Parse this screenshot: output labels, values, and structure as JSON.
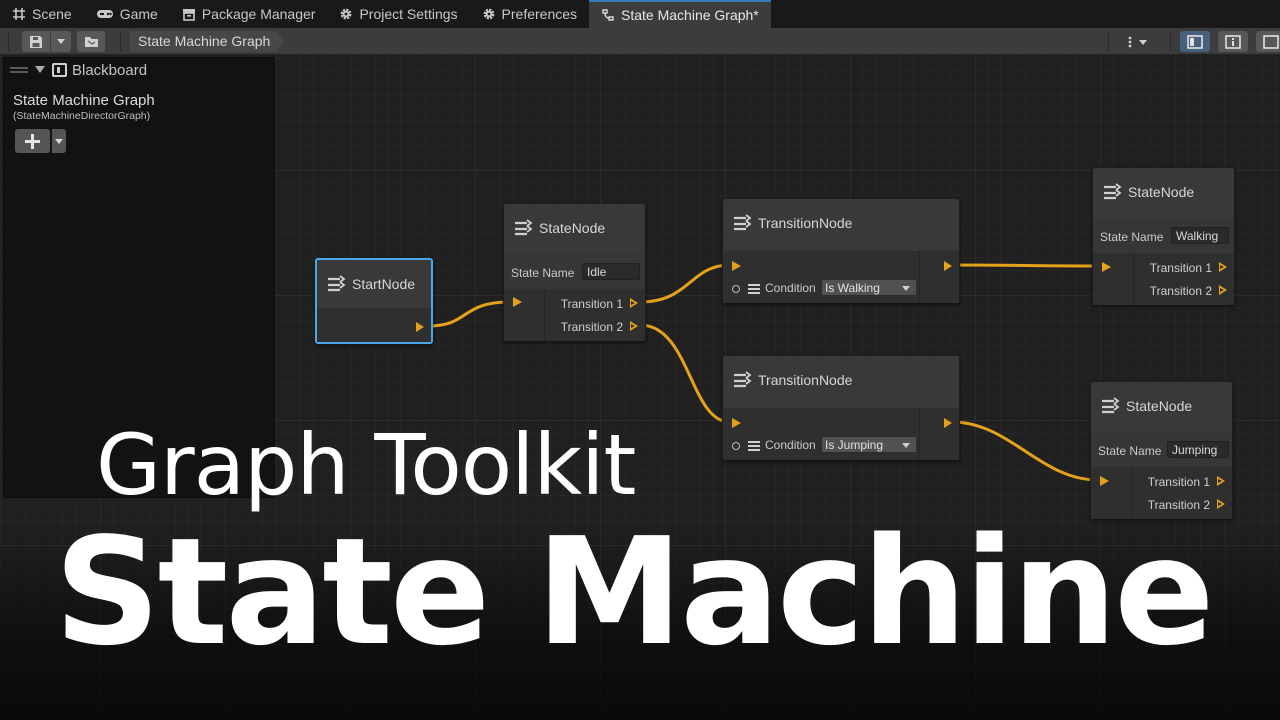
{
  "tabs": [
    {
      "label": "Scene",
      "icon": "grid-icon"
    },
    {
      "label": "Game",
      "icon": "gamepad-icon"
    },
    {
      "label": "Package Manager",
      "icon": "package-icon"
    },
    {
      "label": "Project Settings",
      "icon": "gear-icon"
    },
    {
      "label": "Preferences",
      "icon": "gear-icon"
    },
    {
      "label": "State Machine Graph*",
      "icon": "graph-icon",
      "active": true
    }
  ],
  "toolbar": {
    "breadcrumb": "State Machine Graph",
    "buttons": [
      "save-icon",
      "dropdown-caret-icon",
      "folder-icon",
      "more-icon",
      "blackboard-toggle-icon",
      "inspector-icon",
      "minimap-icon"
    ]
  },
  "blackboard": {
    "header": "Blackboard",
    "title": "State Machine Graph",
    "subtitle": "(StateMachineDirectorGraph)"
  },
  "nodes": {
    "start": {
      "title": "StartNode"
    },
    "idle": {
      "title": "StateNode",
      "state_label": "State Name",
      "state_value": "Idle",
      "out1": "Transition 1",
      "out2": "Transition 2"
    },
    "trans_walk": {
      "title": "TransitionNode",
      "cond_label": "Condition",
      "cond_value": "Is Walking"
    },
    "trans_jump": {
      "title": "TransitionNode",
      "cond_label": "Condition",
      "cond_value": "Is Jumping"
    },
    "walking": {
      "title": "StateNode",
      "state_label": "State Name",
      "state_value": "Walking",
      "out1": "Transition 1",
      "out2": "Transition 2"
    },
    "jumping": {
      "title": "StateNode",
      "state_label": "State Name",
      "state_value": "Jumping",
      "out1": "Transition 1",
      "out2": "Transition 2"
    }
  },
  "overlay": {
    "line1": "Graph Toolkit",
    "line2": "State Machine"
  },
  "colors": {
    "edge": "#e3a21a",
    "selection": "#4aa7e9",
    "active_tab": "#3a79bb"
  }
}
